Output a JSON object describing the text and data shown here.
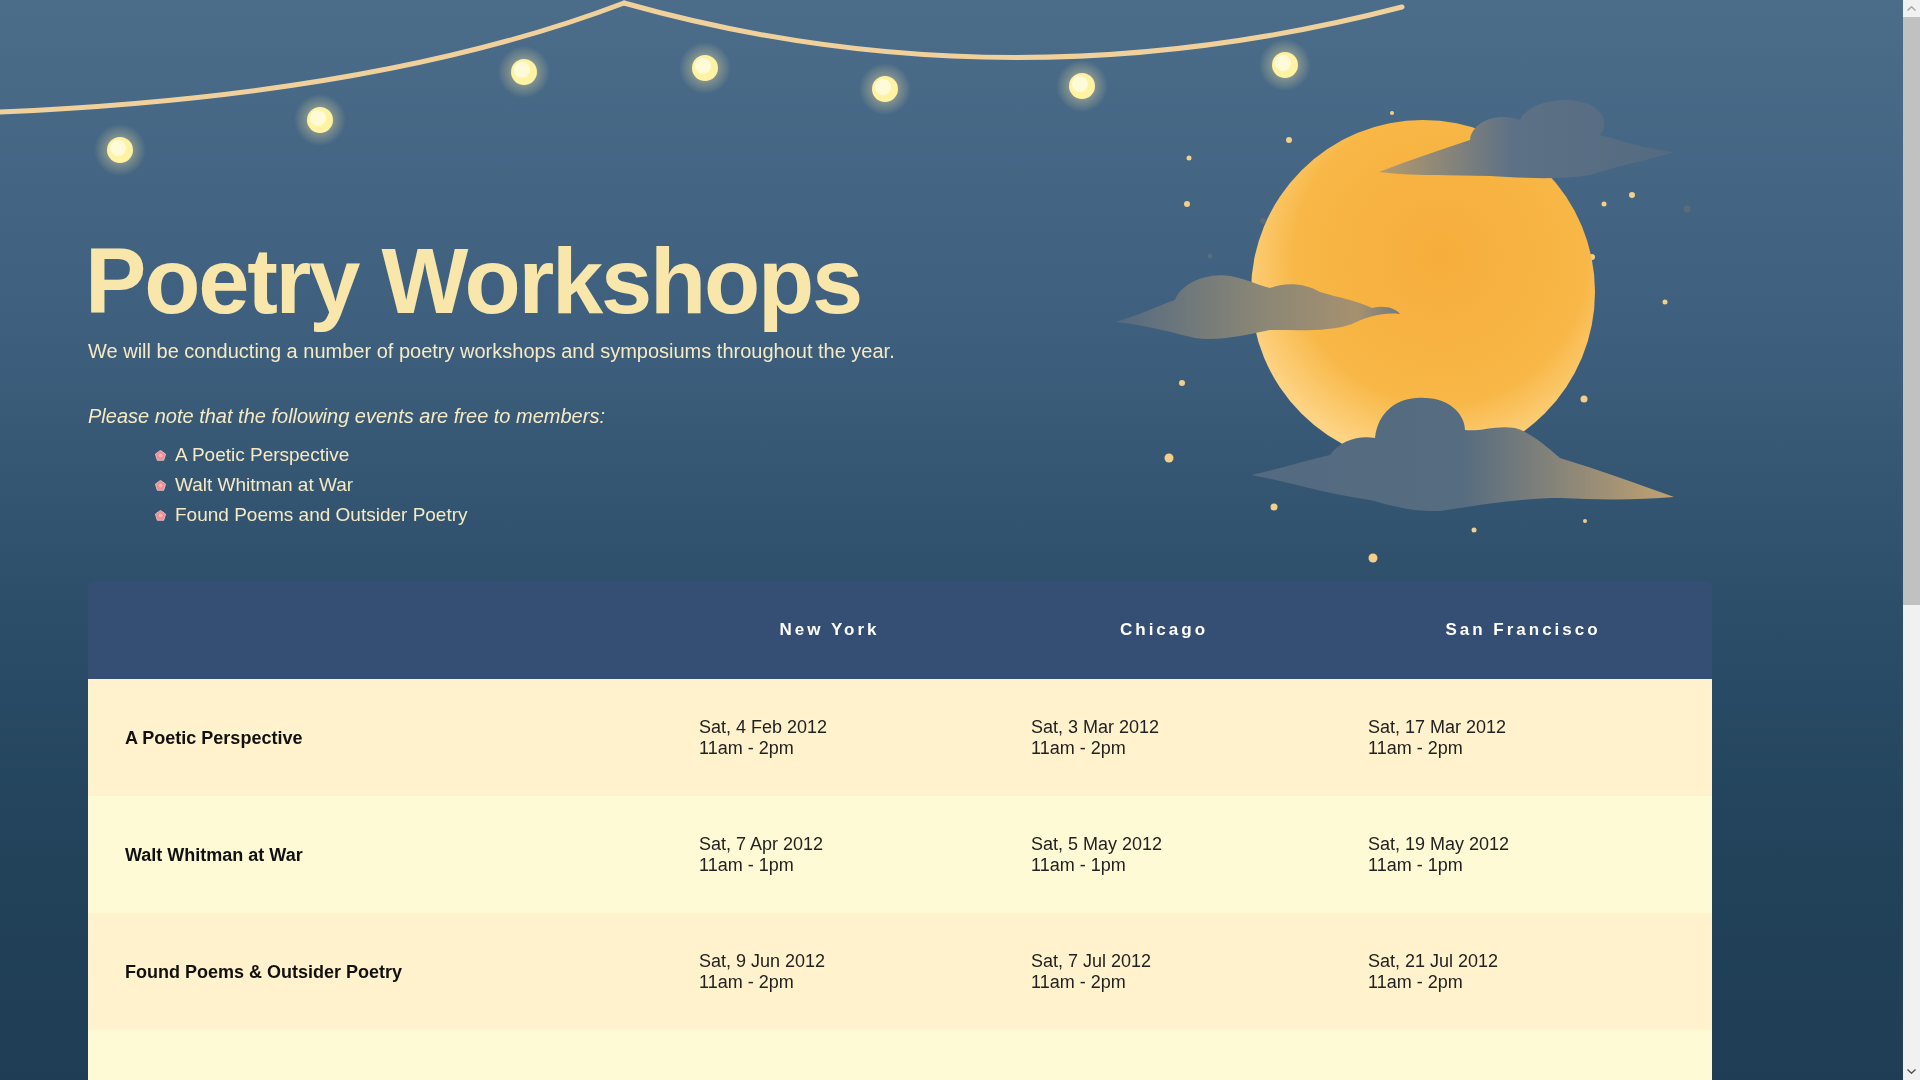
{
  "header": {
    "title": "Poetry Workshops",
    "intro": "We will be conducting a number of poetry workshops and symposiums throughout the year.",
    "note": "Please note that the following events are free to members:",
    "free_events": [
      "A Poetic Perspective",
      "Walt Whitman at War",
      "Found Poems and Outsider Poetry"
    ]
  },
  "schedule": {
    "columns": [
      "New York",
      "Chicago",
      "San Francisco"
    ],
    "rows": [
      {
        "event": "A Poetic Perspective",
        "sessions": [
          {
            "date": "Sat, 4 Feb 2012",
            "time": "11am - 2pm"
          },
          {
            "date": "Sat, 3 Mar 2012",
            "time": "11am - 2pm"
          },
          {
            "date": "Sat, 17 Mar 2012",
            "time": "11am - 2pm"
          }
        ]
      },
      {
        "event": "Walt Whitman at War",
        "sessions": [
          {
            "date": "Sat, 7 Apr 2012",
            "time": "11am - 1pm"
          },
          {
            "date": "Sat, 5 May 2012",
            "time": "11am - 1pm"
          },
          {
            "date": "Sat, 19 May 2012",
            "time": "11am - 1pm"
          }
        ]
      },
      {
        "event": "Found Poems & Outsider Poetry",
        "sessions": [
          {
            "date": "Sat, 9 Jun 2012",
            "time": "11am - 2pm"
          },
          {
            "date": "Sat, 7 Jul 2012",
            "time": "11am - 2pm"
          },
          {
            "date": "Sat, 21 Jul 2012",
            "time": "11am - 2pm"
          }
        ]
      }
    ]
  }
}
